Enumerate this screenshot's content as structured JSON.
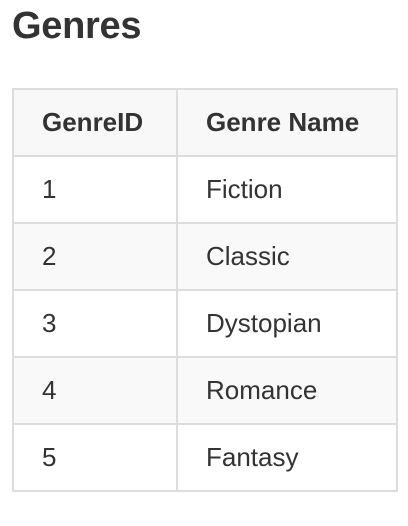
{
  "page": {
    "title": "Genres"
  },
  "table": {
    "headers": [
      "GenreID",
      "Genre Name"
    ],
    "rows": [
      {
        "id": "1",
        "name": "Fiction"
      },
      {
        "id": "2",
        "name": "Classic"
      },
      {
        "id": "3",
        "name": "Dystopian"
      },
      {
        "id": "4",
        "name": "Romance"
      },
      {
        "id": "5",
        "name": "Fantasy"
      }
    ]
  },
  "colors": {
    "text": "#333333",
    "border": "#dddddd",
    "header_bg": "#f8f8f8",
    "stripe_bg": "#f9f9f9"
  }
}
